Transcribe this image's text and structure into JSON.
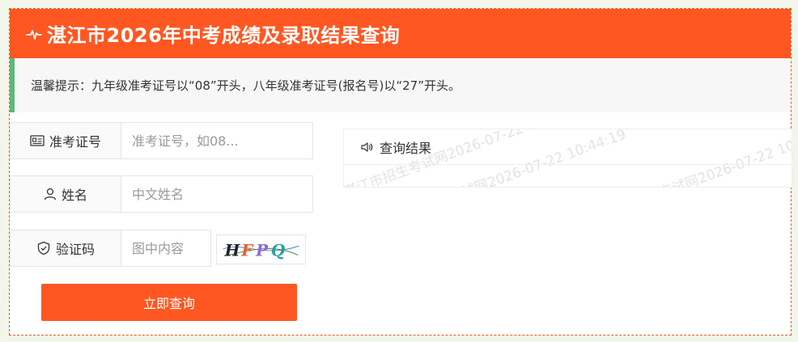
{
  "header": {
    "title": "湛江市2026年中考成绩及录取结果查询"
  },
  "tip": {
    "text": "温馨提示：九年级准考证号以“08”开头，八年级准考证号(报名号)以“27”开头。"
  },
  "form": {
    "exam_no": {
      "label": "准考证号",
      "placeholder": "准考证号，如08..."
    },
    "name": {
      "label": "姓名",
      "placeholder": "中文姓名"
    },
    "captcha": {
      "label": "验证码",
      "placeholder": "图中内容",
      "image_text": "HFPQ"
    },
    "submit_label": "立即查询"
  },
  "result": {
    "title": "查询结果",
    "watermark": "湛江市招生考试网2026-07-22 10:44:19"
  },
  "colors": {
    "accent": "#fe5722",
    "tip_border": "#5fb878"
  }
}
